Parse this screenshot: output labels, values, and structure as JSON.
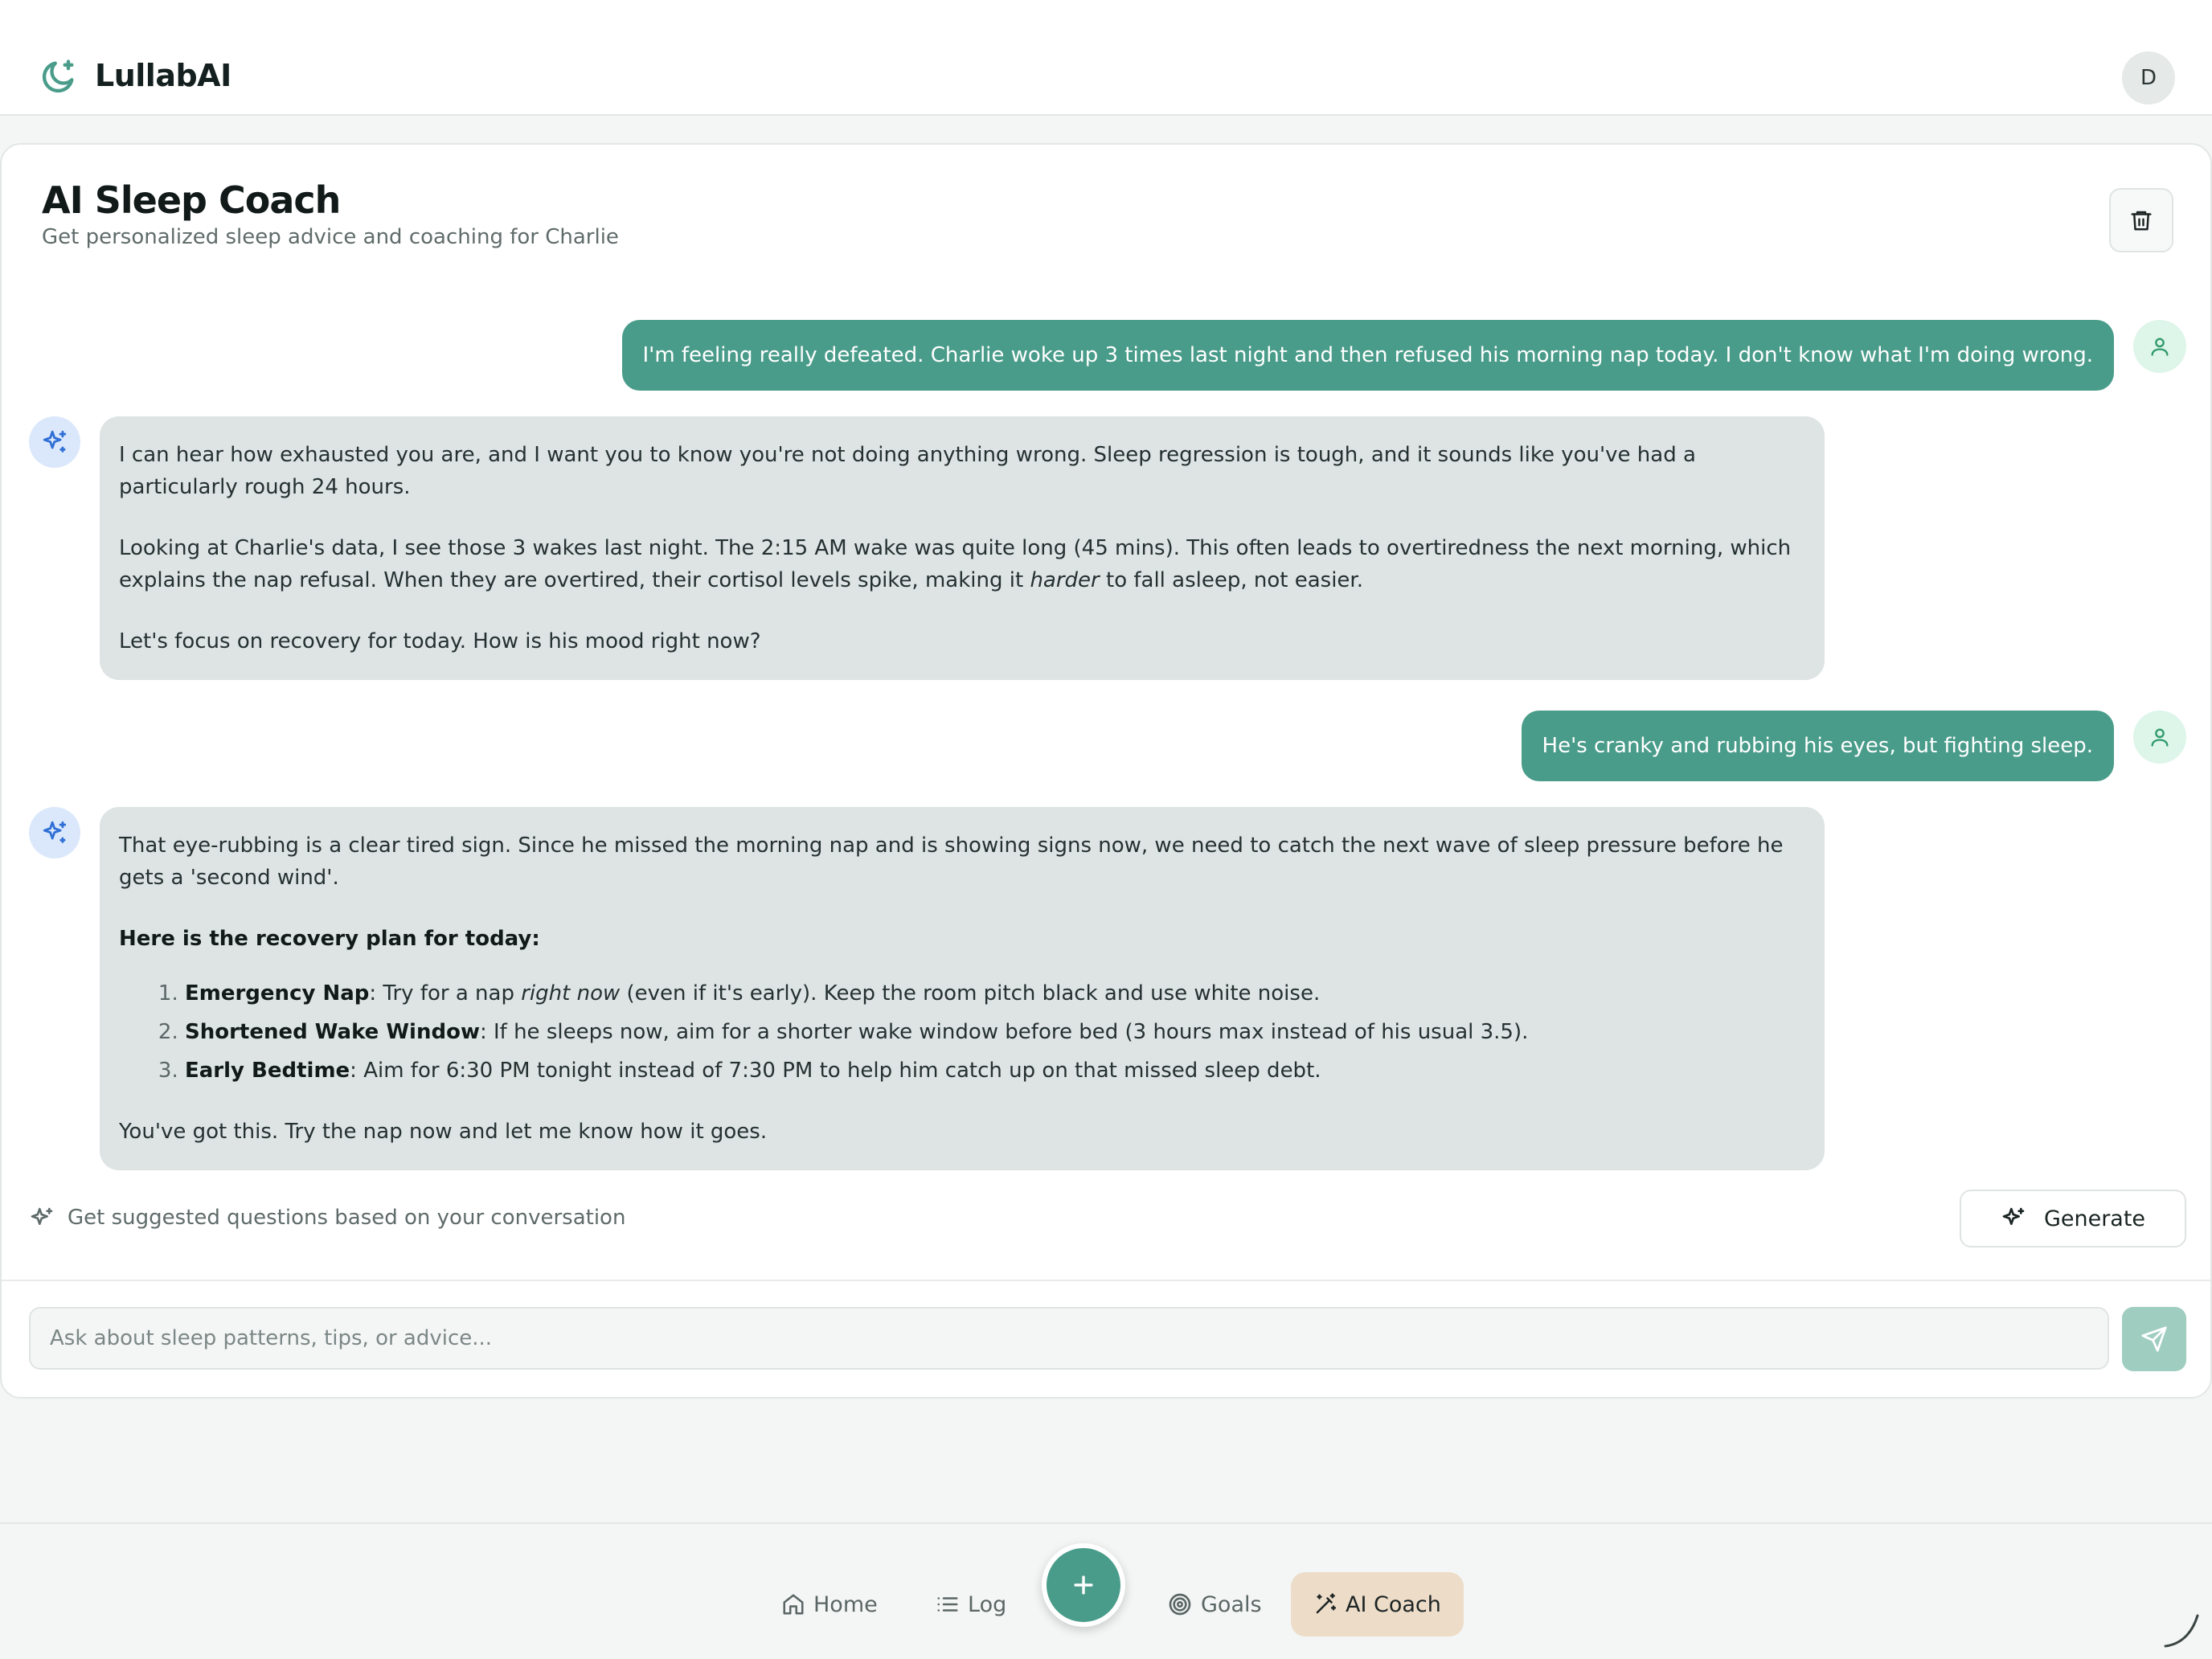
{
  "header": {
    "brand": "LullabAI",
    "avatar_initial": "D"
  },
  "page": {
    "title": "AI Sleep Coach",
    "subtitle": "Get personalized sleep advice and coaching for Charlie"
  },
  "messages": [
    {
      "role": "user",
      "text": "I'm feeling really defeated. Charlie woke up 3 times last night and then refused his morning nap today. I don't know what I'm doing wrong."
    },
    {
      "role": "assistant",
      "p1": "I can hear how exhausted you are, and I want you to know you're not doing anything wrong. Sleep regression is tough, and it sounds like you've had a particularly rough 24 hours.",
      "p2_before": "Looking at Charlie's data, I see those 3 wakes last night. The 2:15 AM wake was quite long (45 mins). This often leads to overtiredness the next morning, which explains the nap refusal. When they are overtired, their cortisol levels spike, making it ",
      "p2_em": "harder",
      "p2_after": " to fall asleep, not easier.",
      "p3": "Let's focus on recovery for today. How is his mood right now?"
    },
    {
      "role": "user",
      "text": "He's cranky and rubbing his eyes, but fighting sleep."
    },
    {
      "role": "assistant",
      "p1": "That eye-rubbing is a clear tired sign. Since he missed the morning nap and is showing signs now, we need to catch the next wave of sleep pressure before he gets a 'second wind'.",
      "plan_heading": "Here is the recovery plan for today:",
      "plan": [
        {
          "title": "Emergency Nap",
          "before": ": Try for a nap ",
          "em": "right now",
          "after": " (even if it's early). Keep the room pitch black and use white noise."
        },
        {
          "title": "Shortened Wake Window",
          "before": ": If he sleeps now, aim for a shorter wake window before bed (3 hours max instead of his usual 3.5).",
          "em": "",
          "after": ""
        },
        {
          "title": "Early Bedtime",
          "before": ": Aim for 6:30 PM tonight instead of 7:30 PM to help him catch up on that missed sleep debt.",
          "em": "",
          "after": ""
        }
      ],
      "closing": "You've got this. Try the nap now and let me know how it goes."
    }
  ],
  "suggestions": {
    "prompt": "Get suggested questions based on your conversation",
    "button_label": "Generate"
  },
  "input": {
    "placeholder": "Ask about sleep patterns, tips, or advice...",
    "value": ""
  },
  "nav": {
    "items": [
      {
        "label": "Home",
        "icon": "home-icon",
        "active": false
      },
      {
        "label": "Log",
        "icon": "list-icon",
        "active": false
      },
      {
        "label": "Goals",
        "icon": "target-icon",
        "active": false
      },
      {
        "label": "AI Coach",
        "icon": "magic-wand-icon",
        "active": true
      }
    ],
    "fab_icon": "plus-icon"
  },
  "colors": {
    "accent": "#4a9c8a",
    "ai_bubble": "#dde4e3",
    "active_nav": "#ecdcc8",
    "send_disabled": "#9fcdc0"
  }
}
